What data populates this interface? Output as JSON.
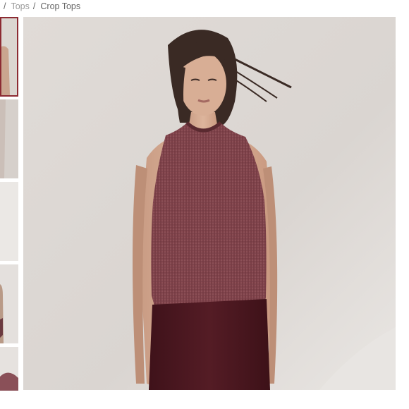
{
  "breadcrumb": {
    "separator_1": "/",
    "parent_label": "Tops",
    "separator_2": "/",
    "current_label": "Crop Tops"
  },
  "thumbnails": {
    "selected_index": 0,
    "count_visible": 5
  },
  "colors": {
    "accent_border": "#8c2b33",
    "garment_top": "#7d4249",
    "garment_skirt": "#4c1820",
    "backdrop": "#dcd7d3"
  }
}
